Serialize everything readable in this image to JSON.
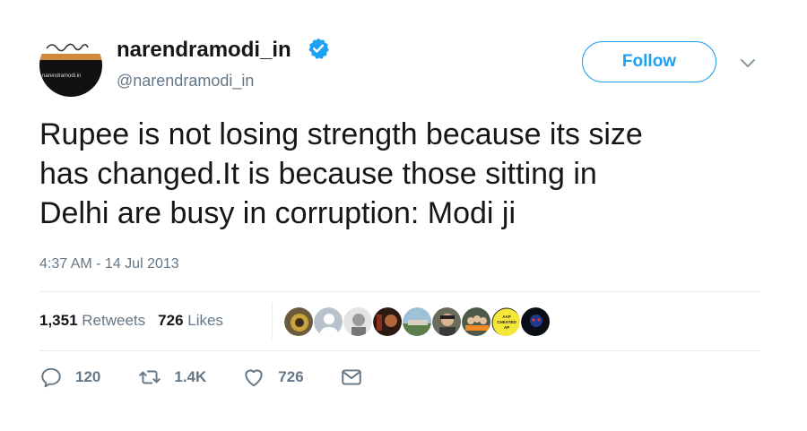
{
  "account": {
    "display_name": "narendramodi_in",
    "handle": "@narendramodi_in",
    "verified": true,
    "avatar_text": "narendramodi.in"
  },
  "follow_label": "Follow",
  "tweet": {
    "line1": "Rupee is not losing strength because its size",
    "line2": "has changed.It is because those sitting in",
    "line3": "Delhi are busy in corruption: Modi ji",
    "timestamp": "4:37 AM - 14 Jul 2013"
  },
  "stats": {
    "retweets_count": "1,351",
    "retweets_label": "Retweets",
    "likes_count": "726",
    "likes_label": "Likes"
  },
  "likers": [
    {
      "name": "liker-1-icon"
    },
    {
      "name": "liker-2-icon"
    },
    {
      "name": "liker-3-icon"
    },
    {
      "name": "liker-4-icon"
    },
    {
      "name": "liker-5-icon"
    },
    {
      "name": "liker-6-icon"
    },
    {
      "name": "liker-7-icon"
    },
    {
      "name": "liker-8-icon",
      "text_lines": [
        "AAP",
        "CHEATED",
        "AP"
      ]
    },
    {
      "name": "liker-9-icon"
    }
  ],
  "actions": {
    "reply_count": "120",
    "retweet_count": "1.4K",
    "like_count": "726"
  },
  "colors": {
    "accent": "#1da1f2",
    "text_secondary": "#657786",
    "text_primary": "#14171a"
  }
}
